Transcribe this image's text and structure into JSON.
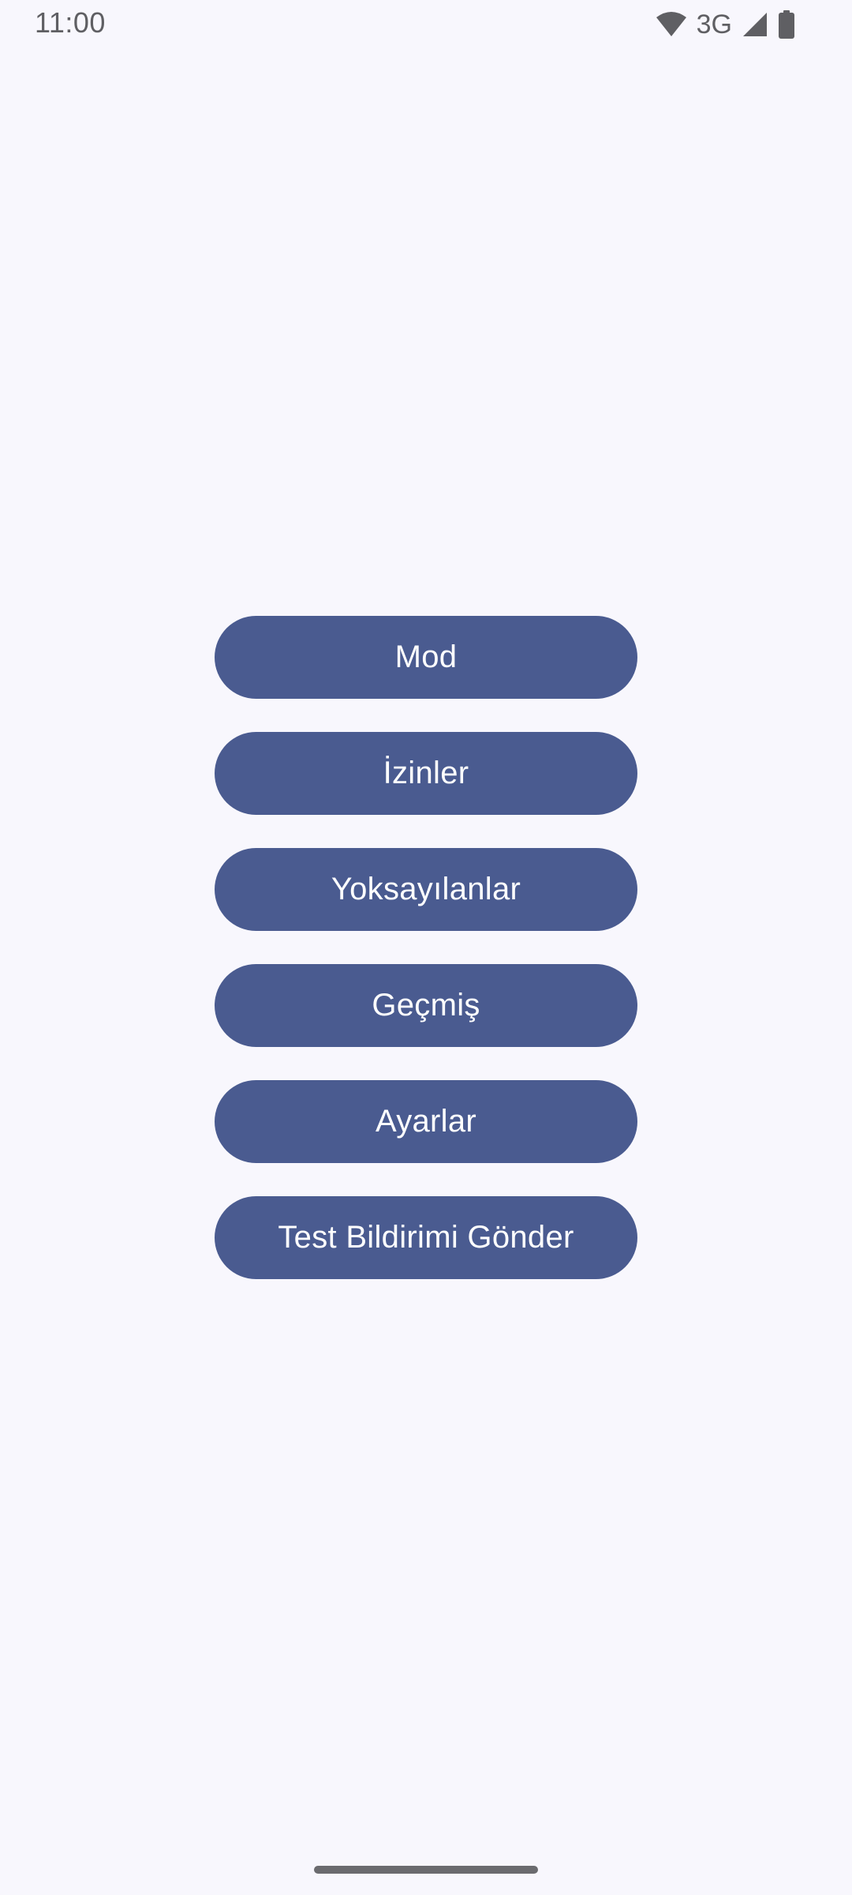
{
  "status_bar": {
    "time": "11:00",
    "network": "3G",
    "icons": [
      "wifi-icon",
      "cellular-signal-icon",
      "battery-icon"
    ]
  },
  "menu": {
    "buttons": [
      {
        "label": "Mod"
      },
      {
        "label": "İzinler"
      },
      {
        "label": "Yoksayılanlar"
      },
      {
        "label": "Geçmiş"
      },
      {
        "label": "Ayarlar"
      },
      {
        "label": "Test Bildirimi Gönder"
      }
    ]
  },
  "colors": {
    "background": "#f8f7fd",
    "button": "#4a5b90",
    "button_text": "#ffffff",
    "status_text": "#5f5f63"
  }
}
